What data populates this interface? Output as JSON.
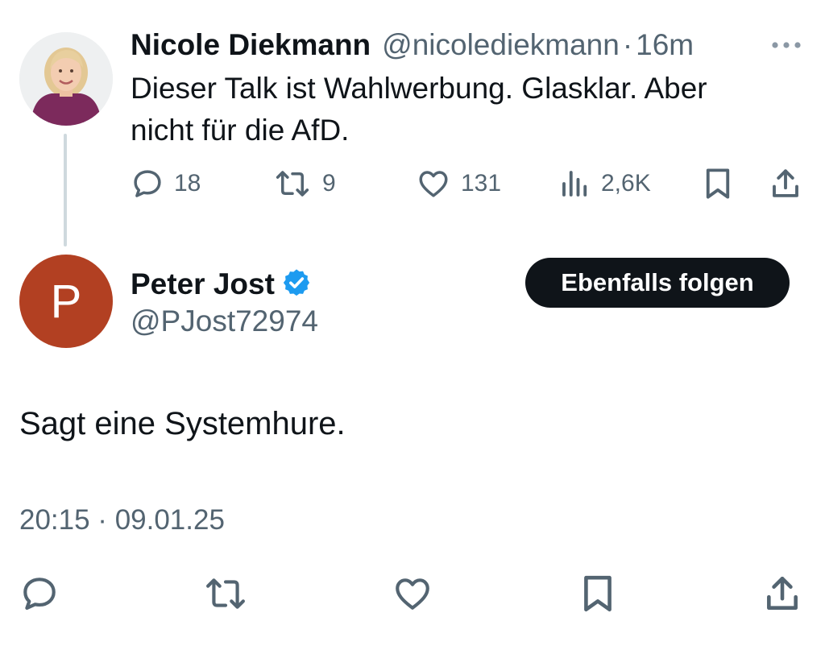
{
  "parent_tweet": {
    "author_name": "Nicole Diekmann",
    "handle": "@nicolediekmann",
    "separator": "·",
    "time_ago": "16m",
    "text": "Dieser Talk ist Wahlwerbung. Glasklar. Aber nicht für die AfD.",
    "actions": {
      "replies": "18",
      "reposts": "9",
      "likes": "131",
      "views": "2,6K"
    },
    "icons": [
      "more-icon",
      "reply-icon",
      "repost-icon",
      "like-icon",
      "views-icon",
      "bookmark-icon",
      "share-icon"
    ]
  },
  "reply_tweet": {
    "avatar_letter": "P",
    "author_name": "Peter Jost",
    "handle": "@PJost72974",
    "verified": true,
    "follow_label": "Ebenfalls folgen",
    "text": "Sagt eine Systemhure.",
    "timestamp": "20:15 · 09.01.25",
    "icons": [
      "verified-badge-icon",
      "reply-icon",
      "repost-icon",
      "like-icon",
      "bookmark-icon",
      "share-icon"
    ]
  },
  "colors": {
    "text_primary": "#0f1419",
    "text_secondary": "#536471",
    "thread_line": "#cfd9de",
    "verified_blue": "#1d9bf0",
    "avatar_p_background": "#b24022",
    "button_background": "#0f1419",
    "button_text": "#ffffff"
  }
}
